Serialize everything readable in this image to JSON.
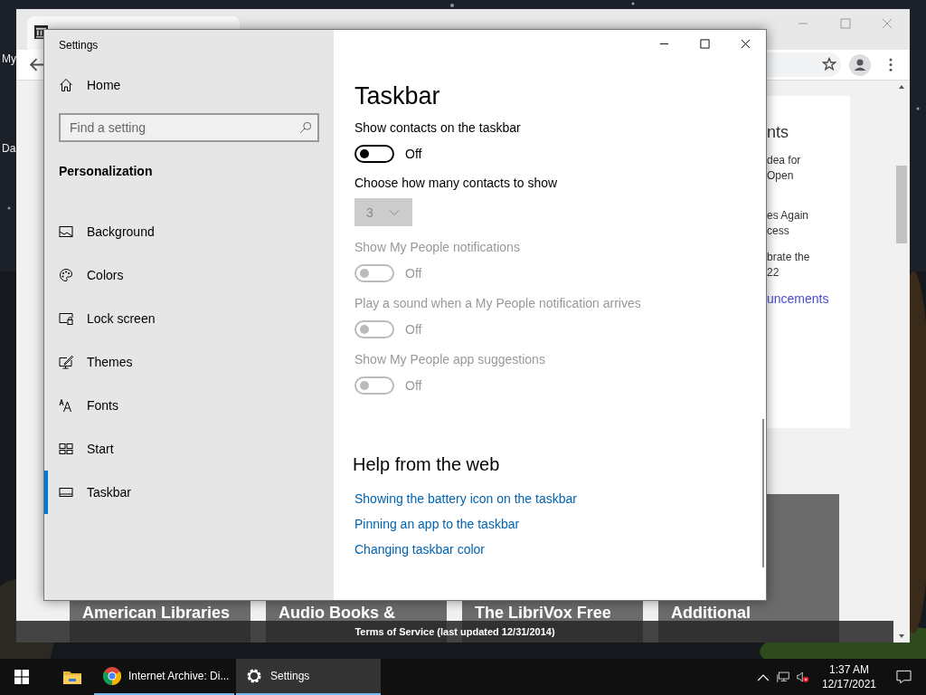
{
  "desktop": {
    "icon_labels": [
      "My",
      "Da"
    ]
  },
  "browser": {
    "card": {
      "heading": "nts",
      "items": [
        [
          "dea for",
          "Open"
        ],
        [
          "es Again",
          "cess"
        ],
        [
          "brate the",
          "22"
        ]
      ],
      "link": "uncements"
    },
    "tiles": [
      {
        "lines": [
          "American Libraries"
        ]
      },
      {
        "lines": [
          "Audio Books &"
        ]
      },
      {
        "lines": [
          "The LibriVox Free"
        ]
      },
      {
        "lines": [
          "Additional"
        ]
      }
    ],
    "footer": "Terms of Service (last updated 12/31/2014)"
  },
  "settings": {
    "title": "Settings",
    "sidebar": {
      "home": "Home",
      "search": {
        "placeholder": "Find a setting"
      },
      "section": "Personalization",
      "items": [
        {
          "label": "Background",
          "selected": false
        },
        {
          "label": "Colors",
          "selected": false
        },
        {
          "label": "Lock screen",
          "selected": false
        },
        {
          "label": "Themes",
          "selected": false
        },
        {
          "label": "Fonts",
          "selected": false
        },
        {
          "label": "Start",
          "selected": false
        },
        {
          "label": "Taskbar",
          "selected": true
        }
      ]
    },
    "page": {
      "title": "Taskbar",
      "settings": [
        {
          "kind": "toggle",
          "label": "Show contacts on the taskbar",
          "on": false,
          "disabled": false,
          "state_text": "Off"
        },
        {
          "kind": "dropdown",
          "label": "Choose how many contacts to show",
          "value": "3",
          "disabled": true
        },
        {
          "kind": "toggle",
          "label": "Show My People notifications",
          "on": false,
          "disabled": true,
          "state_text": "Off"
        },
        {
          "kind": "toggle",
          "label": "Play a sound when a My People notification arrives",
          "on": false,
          "disabled": true,
          "state_text": "Off"
        },
        {
          "kind": "toggle",
          "label": "Show My People app suggestions",
          "on": false,
          "disabled": true,
          "state_text": "Off"
        }
      ],
      "help": {
        "title": "Help from the web",
        "links": [
          "Showing the battery icon on the taskbar",
          "Pinning an app to the taskbar",
          "Changing taskbar color"
        ]
      }
    }
  },
  "taskbar": {
    "apps": [
      {
        "kind": "explorer",
        "selected": false
      },
      {
        "kind": "chrome",
        "label": "Internet Archive: Di...",
        "selected": false
      },
      {
        "kind": "settings",
        "label": "Settings",
        "selected": true
      }
    ],
    "time": "1:37 AM",
    "date": "12/17/2021"
  }
}
